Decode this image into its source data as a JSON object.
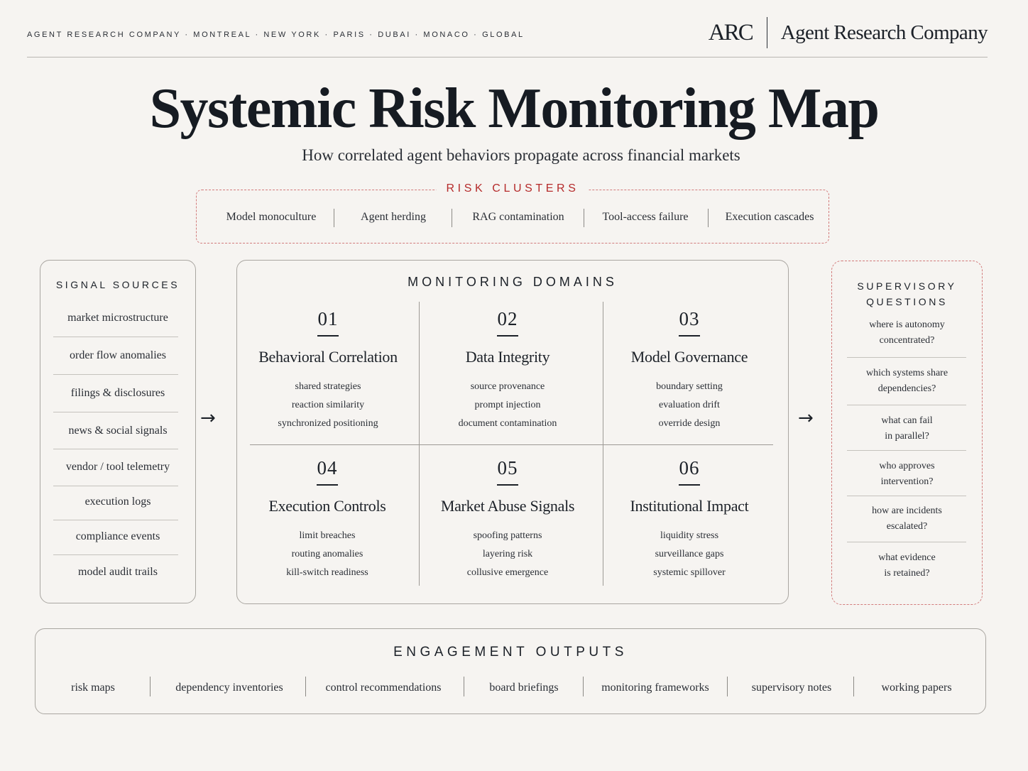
{
  "header": {
    "tagline": "AGENT RESEARCH COMPANY · MONTREAL · NEW YORK · PARIS · DUBAI · MONACO · GLOBAL",
    "brand_mark": "ARC",
    "brand_name": "Agent Research Company"
  },
  "title": "Systemic Risk Monitoring Map",
  "subtitle": "How correlated agent behaviors propagate across financial markets",
  "risk_clusters": {
    "title": "RISK CLUSTERS",
    "items": [
      "Model monoculture",
      "Agent herding",
      "RAG contamination",
      "Tool-access failure",
      "Execution cascades"
    ]
  },
  "signal_sources": {
    "title": "SIGNAL SOURCES",
    "items": [
      "market microstructure",
      "order flow anomalies",
      "filings & disclosures",
      "news & social signals",
      "vendor / tool telemetry",
      "execution logs",
      "compliance events",
      "model audit trails"
    ]
  },
  "arrows": {
    "left": "→",
    "right": "→"
  },
  "monitoring_domains": {
    "title": "MONITORING DOMAINS",
    "cells": [
      {
        "num": "01",
        "title": "Behavioral Correlation",
        "items": [
          "shared strategies",
          "reaction similarity",
          "synchronized positioning"
        ]
      },
      {
        "num": "02",
        "title": "Data Integrity",
        "items": [
          "source provenance",
          "prompt injection",
          "document contamination"
        ]
      },
      {
        "num": "03",
        "title": "Model Governance",
        "items": [
          "boundary setting",
          "evaluation drift",
          "override design"
        ]
      },
      {
        "num": "04",
        "title": "Execution Controls",
        "items": [
          "limit breaches",
          "routing anomalies",
          "kill-switch readiness"
        ]
      },
      {
        "num": "05",
        "title": "Market Abuse Signals",
        "items": [
          "spoofing patterns",
          "layering risk",
          "collusive emergence"
        ]
      },
      {
        "num": "06",
        "title": "Institutional Impact",
        "items": [
          "liquidity stress",
          "surveillance gaps",
          "systemic spillover"
        ]
      }
    ]
  },
  "supervisory_questions": {
    "title_line1": "SUPERVISORY",
    "title_line2": "QUESTIONS",
    "items": [
      {
        "line1": "where is autonomy",
        "line2": "concentrated?"
      },
      {
        "line1": "which systems share",
        "line2": "dependencies?"
      },
      {
        "line1": "what can fail",
        "line2": "in parallel?"
      },
      {
        "line1": "who approves",
        "line2": "intervention?"
      },
      {
        "line1": "how are incidents",
        "line2": "escalated?"
      },
      {
        "line1": "what evidence",
        "line2": "is retained?"
      }
    ]
  },
  "engagement_outputs": {
    "title": "ENGAGEMENT OUTPUTS",
    "items": [
      "risk maps",
      "dependency inventories",
      "control recommendations",
      "board briefings",
      "monitoring frameworks",
      "supervisory notes",
      "working papers"
    ]
  },
  "colors": {
    "background": "#f6f4f1",
    "ink": "#1c2128",
    "accent_red": "#b52b2b",
    "dashed_red": "#d27b7b"
  }
}
